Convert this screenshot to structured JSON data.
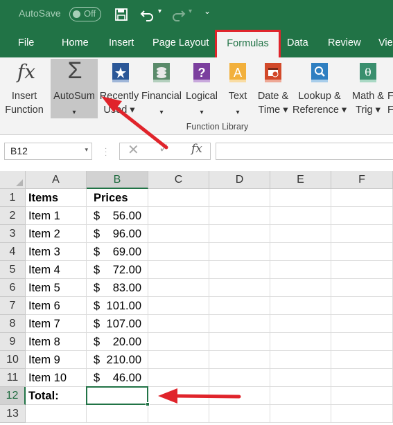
{
  "titlebar": {
    "autosave_label": "AutoSave",
    "autosave_state": "Off",
    "icons": [
      "save-icon",
      "undo-icon",
      "redo-icon",
      "customize-toolbar-icon"
    ]
  },
  "tabs": [
    "File",
    "Home",
    "Insert",
    "Page Layout",
    "Formulas",
    "Data",
    "Review",
    "Vie"
  ],
  "active_tab": "Formulas",
  "ribbon": {
    "insert_function": {
      "line1": "Insert",
      "line2": "Function"
    },
    "autosum": {
      "line1": "AutoSum",
      "line2": "▾"
    },
    "recently_used": {
      "line1": "Recently",
      "line2": "Used ▾"
    },
    "financial": {
      "line1": "Financial",
      "line2": "▾"
    },
    "logical": {
      "line1": "Logical",
      "line2": "▾"
    },
    "text": {
      "line1": "Text",
      "line2": "▾"
    },
    "date_time": {
      "line1": "Date &",
      "line2": "Time ▾"
    },
    "lookup": {
      "line1": "Lookup &",
      "line2": "Reference ▾"
    },
    "math": {
      "line1": "Math &",
      "line2": "Trig ▾"
    },
    "more": {
      "line1": "F",
      "line2": "F"
    },
    "group_label": "Function Library"
  },
  "formula_bar": {
    "name_box": "B12",
    "cancel_symbol": "✕",
    "enter_symbol": "✓",
    "fx_symbol": "fx",
    "formula": ""
  },
  "grid": {
    "columns": [
      "A",
      "B",
      "C",
      "D",
      "E",
      "F"
    ],
    "selected_column": "B",
    "selected_row": "12",
    "rows": [
      {
        "num": "1",
        "a": "Items",
        "b_currency": "",
        "b_value": "Prices",
        "bold": true
      },
      {
        "num": "2",
        "a": "Item 1",
        "b_currency": "$",
        "b_value": "56.00"
      },
      {
        "num": "3",
        "a": "Item 2",
        "b_currency": "$",
        "b_value": "96.00"
      },
      {
        "num": "4",
        "a": "Item 3",
        "b_currency": "$",
        "b_value": "69.00"
      },
      {
        "num": "5",
        "a": "Item 4",
        "b_currency": "$",
        "b_value": "72.00"
      },
      {
        "num": "6",
        "a": "Item 5",
        "b_currency": "$",
        "b_value": "83.00"
      },
      {
        "num": "7",
        "a": "Item 6",
        "b_currency": "$",
        "b_value": "101.00"
      },
      {
        "num": "8",
        "a": "Item 7",
        "b_currency": "$",
        "b_value": "107.00"
      },
      {
        "num": "9",
        "a": "Item 8",
        "b_currency": "$",
        "b_value": "20.00"
      },
      {
        "num": "10",
        "a": "Item 9",
        "b_currency": "$",
        "b_value": "210.00"
      },
      {
        "num": "11",
        "a": "Item 10",
        "b_currency": "$",
        "b_value": "46.00"
      },
      {
        "num": "12",
        "a": "Total:",
        "b_currency": "",
        "b_value": "",
        "bold_a": true
      },
      {
        "num": "13",
        "a": "",
        "b_currency": "",
        "b_value": ""
      }
    ]
  },
  "colors": {
    "excel_green": "#217346",
    "highlight_red": "#e0242b",
    "ribbon_bg": "#f3f3f3"
  }
}
